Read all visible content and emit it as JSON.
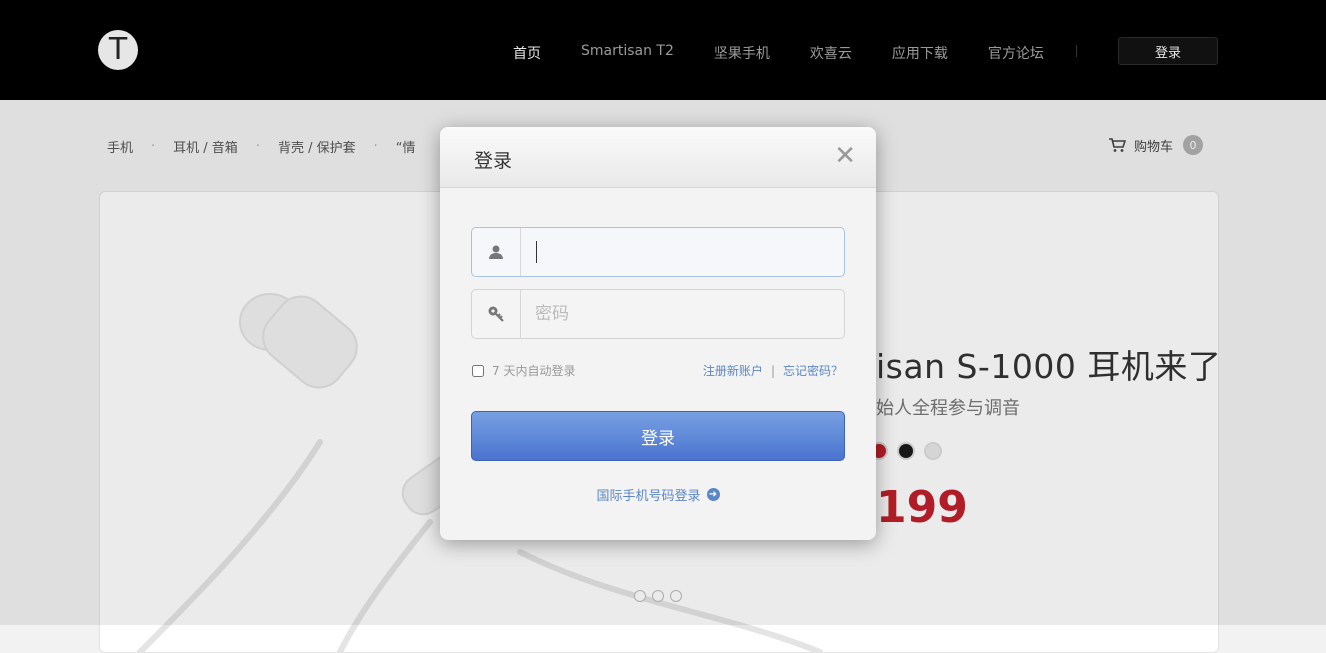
{
  "header": {
    "logo_letter": "T",
    "nav": [
      "首页",
      "Smartisan T2",
      "坚果手机",
      "欢喜云",
      "应用下载",
      "官方论坛"
    ],
    "login_label": "登录"
  },
  "subnav": {
    "items": [
      "手机",
      "耳机 / 音箱",
      "背壳 / 保护套",
      "“情"
    ],
    "cart_label": "购物车",
    "cart_count": "0"
  },
  "hero": {
    "title": "isan S-1000 耳机来了",
    "subtitle": "始人全程参与调音",
    "price": "199",
    "swatch_colors": [
      "#c0202a",
      "#1a1a1a",
      "#e8e8e8"
    ]
  },
  "modal": {
    "title": "登录",
    "close": "✕",
    "username_value": "",
    "password_placeholder": "密码",
    "remember_label": "7 天内自动登录",
    "register_link": "注册新账户",
    "forgot_link": "忘记密码？",
    "submit_label": "登录",
    "intl_login": "国际手机号码登录"
  }
}
